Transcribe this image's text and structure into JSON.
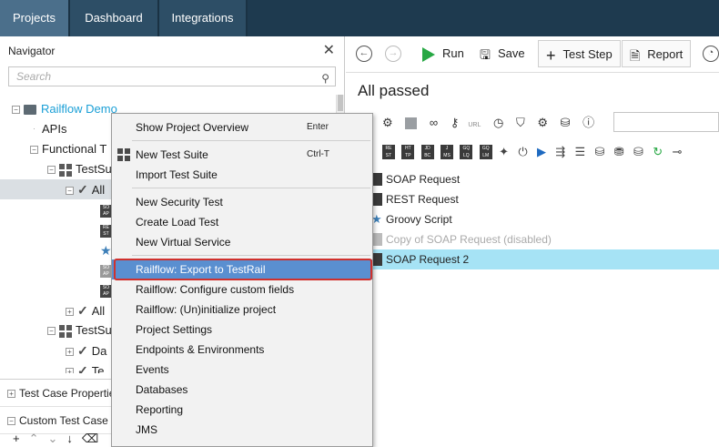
{
  "tabs": [
    {
      "label": "Projects",
      "active": true
    },
    {
      "label": "Dashboard",
      "active": false
    },
    {
      "label": "Integrations",
      "active": false
    }
  ],
  "navigator": {
    "title": "Navigator",
    "search_placeholder": "Search",
    "tree": {
      "project": "Railflow Demo",
      "apis": "APIs",
      "functional": "Functional T",
      "suite1": "TestSu",
      "all1": "All",
      "all2": "All",
      "suite2": "TestSu",
      "da": "Da",
      "te": "Te"
    },
    "sections": {
      "test_case_properties": "Test Case Properties",
      "custom_test_case": "Custom Test Case I"
    }
  },
  "toolbar": {
    "run": "Run",
    "save": "Save",
    "test_step": "Test Step",
    "report": "Report"
  },
  "editor": {
    "status": "All passed",
    "url_label": "URL",
    "steps": [
      {
        "label": "SOAP Request",
        "state": "normal"
      },
      {
        "label": "REST Request",
        "state": "normal"
      },
      {
        "label": "Groovy Script",
        "state": "normal"
      },
      {
        "label": "Copy of SOAP Request (disabled)",
        "state": "disabled"
      },
      {
        "label": "SOAP Request 2",
        "state": "selected"
      }
    ]
  },
  "context_menu": {
    "items": [
      {
        "label": "Show Project Overview",
        "shortcut": "Enter"
      },
      {
        "label": "New Test Suite",
        "shortcut": "Ctrl-T"
      },
      {
        "label": "Import Test Suite",
        "shortcut": ""
      },
      {
        "label": "New Security Test",
        "shortcut": ""
      },
      {
        "label": "Create Load Test",
        "shortcut": ""
      },
      {
        "label": "New Virtual Service",
        "shortcut": ""
      },
      {
        "label": "Railflow: Export to TestRail",
        "shortcut": ""
      },
      {
        "label": "Railflow: Configure custom fields",
        "shortcut": ""
      },
      {
        "label": "Railflow: (Un)initialize project",
        "shortcut": ""
      },
      {
        "label": "Project Settings",
        "shortcut": ""
      },
      {
        "label": "Endpoints & Environments",
        "shortcut": ""
      },
      {
        "label": "Events",
        "shortcut": ""
      },
      {
        "label": "Databases",
        "shortcut": ""
      },
      {
        "label": "Reporting",
        "shortcut": ""
      },
      {
        "label": "JMS",
        "shortcut": ""
      }
    ]
  },
  "colors": {
    "topbar": "#1e3a4f",
    "tab_active": "#4b6f8b",
    "menu_highlight": "#5a8fd0",
    "highlight_outline": "#d0312d",
    "step_selected": "#a6e3f5",
    "run_green": "#27a844",
    "project_link": "#1a9fd6"
  }
}
